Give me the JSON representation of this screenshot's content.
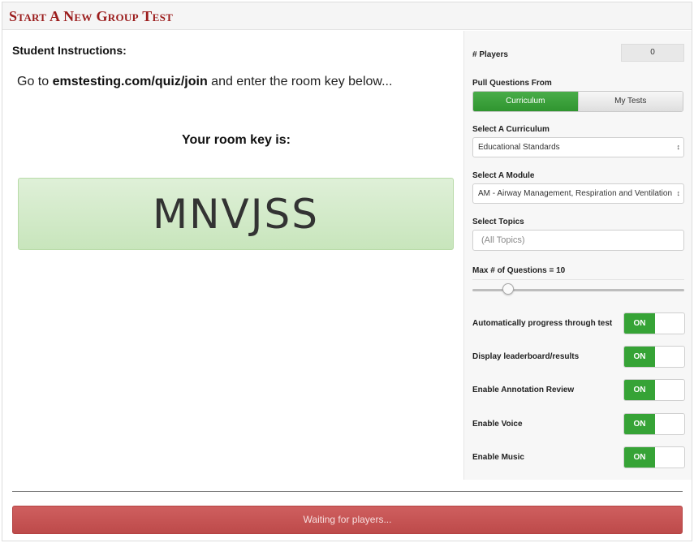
{
  "header": {
    "title": "Start A New Group Test"
  },
  "instructions": {
    "heading": "Student Instructions:",
    "line_prefix": "Go to ",
    "url": "emstesting.com/quiz/join",
    "line_suffix": " and enter the room key below...",
    "key_label": "Your room key is:",
    "room_key": "MNVJSS"
  },
  "settings": {
    "players_label": "# Players",
    "players_value": "0",
    "pull_label": "Pull Questions From",
    "source_options": [
      {
        "label": "Curriculum",
        "selected": true
      },
      {
        "label": "My Tests",
        "selected": false
      }
    ],
    "curriculum_label": "Select A Curriculum",
    "curriculum_value": "Educational Standards",
    "module_label": "Select A Module",
    "module_value": "AM - Airway Management, Respiration and Ventilation",
    "topics_label": "Select Topics",
    "topics_placeholder": "(All Topics)",
    "max_questions_label": "Max # of Questions = 10",
    "max_questions_fraction": 0.15,
    "toggles": [
      {
        "label": "Automatically progress through test",
        "state": "ON"
      },
      {
        "label": "Display leaderboard/results",
        "state": "ON"
      },
      {
        "label": "Enable Annotation Review",
        "state": "ON"
      },
      {
        "label": "Enable Voice",
        "state": "ON"
      },
      {
        "label": "Enable Music",
        "state": "ON"
      }
    ]
  },
  "footer": {
    "status_button": "Waiting for players..."
  },
  "colors": {
    "title_red": "#9b1c1c",
    "key_green": "#dff0d8",
    "toggle_green": "#36a336",
    "wait_red": "#c55555"
  }
}
